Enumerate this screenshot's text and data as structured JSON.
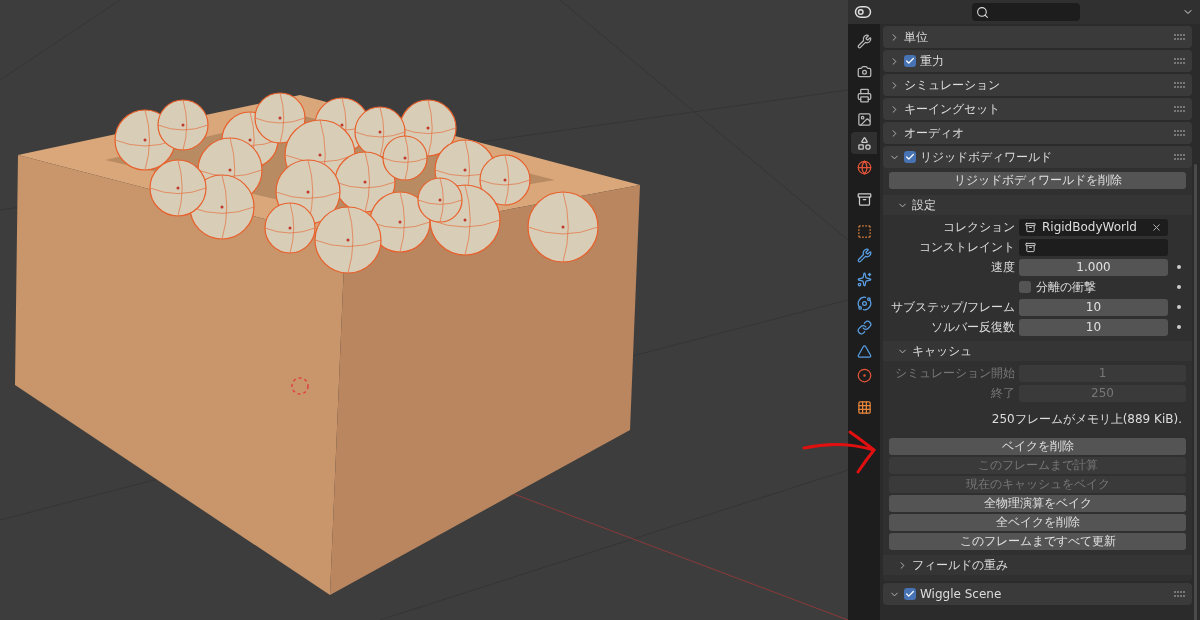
{
  "properties_editor": {
    "tabs": [
      {
        "kind": "tool",
        "selected": false
      },
      {
        "kind": "render",
        "selected": false
      },
      {
        "kind": "output",
        "selected": false
      },
      {
        "kind": "view_layer",
        "selected": false
      },
      {
        "kind": "scene",
        "selected": true
      },
      {
        "kind": "world",
        "selected": false
      },
      {
        "kind": "collection",
        "selected": false
      },
      {
        "kind": "object",
        "selected": false
      },
      {
        "kind": "modifier",
        "selected": false
      },
      {
        "kind": "particles",
        "selected": false
      },
      {
        "kind": "physics",
        "selected": false
      },
      {
        "kind": "constraint",
        "selected": false
      },
      {
        "kind": "data",
        "selected": false
      },
      {
        "kind": "material",
        "selected": false
      },
      {
        "kind": "texture",
        "selected": false
      }
    ],
    "panels": [
      {
        "label": "単位",
        "kind": "plain",
        "expanded": false
      },
      {
        "label": "重力",
        "kind": "toggle",
        "checked": true,
        "expanded": false
      },
      {
        "label": "シミュレーション",
        "kind": "plain",
        "expanded": false
      },
      {
        "label": "キーイングセット",
        "kind": "plain",
        "expanded": false
      },
      {
        "label": "オーディオ",
        "kind": "plain",
        "expanded": false
      },
      {
        "label": "リジッドボディワールド",
        "kind": "toggle",
        "checked": true,
        "expanded": true,
        "content": {
          "remove_button": "リジッドボディワールドを削除",
          "subpanels": [
            {
              "label": "設定",
              "expanded": true,
              "rows": [
                {
                  "kind": "collection",
                  "label": "コレクション",
                  "value": "RigidBodyWorld",
                  "clearable": true
                },
                {
                  "kind": "collection",
                  "label": "コンストレイント"
                },
                {
                  "kind": "number",
                  "label": "速度",
                  "value": "1.000",
                  "animatable": true
                },
                {
                  "kind": "checkbox",
                  "label": "分離の衝撃",
                  "checked": false,
                  "animatable": true
                },
                {
                  "kind": "number",
                  "label": "サブステップ/フレーム",
                  "value": "10",
                  "animatable": true
                },
                {
                  "kind": "number",
                  "label": "ソルバー反復数",
                  "value": "10",
                  "animatable": true
                }
              ]
            },
            {
              "label": "キャッシュ",
              "expanded": true,
              "rows": [
                {
                  "kind": "number",
                  "label": "シミュレーション開始",
                  "value": "1",
                  "disabled": true
                },
                {
                  "kind": "number",
                  "label": "終了",
                  "value": "250",
                  "disabled": true
                }
              ],
              "info": "250フレームがメモリ上(889 KiB).",
              "buttons": [
                {
                  "label": "ベイクを削除",
                  "disabled": false
                },
                {
                  "label": "このフレームまで計算",
                  "disabled": true
                },
                {
                  "label": "現在のキャッシュをベイク",
                  "disabled": true
                },
                {
                  "label": "全物理演算をベイク",
                  "disabled": false
                },
                {
                  "label": "全ベイクを削除",
                  "disabled": false
                },
                {
                  "label": "このフレームまですべて更新",
                  "disabled": false
                }
              ]
            },
            {
              "label": "フィールドの重み",
              "expanded": false
            }
          ]
        }
      },
      {
        "label": "Wiggle Scene",
        "kind": "toggle",
        "checked": true,
        "expanded": true
      }
    ]
  }
}
